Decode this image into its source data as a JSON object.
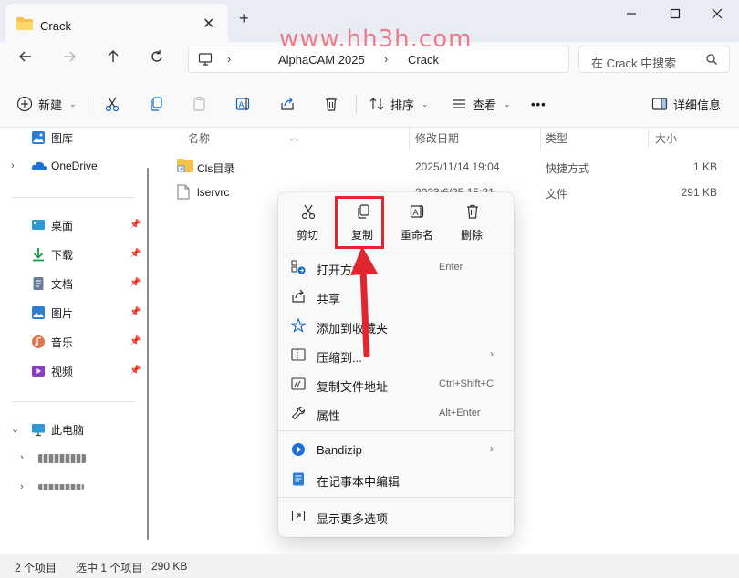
{
  "window": {
    "tab_title": "Crack",
    "new_tab": "+",
    "close_tab": "✕"
  },
  "watermark": "www.hh3h.com",
  "address": {
    "crumbs": [
      "AlphaCAM 2025",
      "Crack"
    ],
    "search_placeholder": "在 Crack 中搜索"
  },
  "toolbar": {
    "new_label": "新建",
    "sort_label": "排序",
    "view_label": "查看",
    "more_label": "•••",
    "details_label": "详细信息"
  },
  "sidebar": {
    "top_item": "图库",
    "onedrive": "OneDrive",
    "quick_access": [
      {
        "label": "桌面",
        "icon": "desktop-icon"
      },
      {
        "label": "下载",
        "icon": "download-icon"
      },
      {
        "label": "文档",
        "icon": "document-icon"
      },
      {
        "label": "图片",
        "icon": "pictures-icon"
      },
      {
        "label": "音乐",
        "icon": "music-icon"
      },
      {
        "label": "视频",
        "icon": "video-icon"
      }
    ],
    "this_pc": "此电脑"
  },
  "columns": {
    "name": "名称",
    "date": "修改日期",
    "type": "类型",
    "size": "大小"
  },
  "files": [
    {
      "name": "Cls目录",
      "date": "2025/11/14 19:04",
      "type": "快捷方式",
      "size": "1 KB"
    },
    {
      "name": "lservrc",
      "date": "2023/6/25 15:21",
      "type": "文件",
      "size": "291 KB"
    }
  ],
  "context_menu": {
    "quick_actions": [
      "剪切",
      "复制",
      "重命名",
      "删除"
    ],
    "items": [
      {
        "label": "打开方式",
        "key": "Enter",
        "icon": "open-with-icon"
      },
      {
        "label": "共享",
        "key": "",
        "icon": "share-icon"
      },
      {
        "label": "添加到收藏夹",
        "key": "",
        "icon": "star-icon"
      },
      {
        "label": "压缩到...",
        "key": "",
        "icon": "zip-folder-icon"
      },
      {
        "label": "复制文件地址",
        "key": "Ctrl+Shift+C",
        "icon": "copy-path-icon"
      },
      {
        "label": "属性",
        "key": "Alt+Enter",
        "icon": "wrench-icon"
      }
    ],
    "items2": [
      {
        "label": "Bandizip",
        "icon": "bandizip-icon"
      },
      {
        "label": "在记事本中编辑",
        "icon": "notepad-icon"
      }
    ],
    "more": "显示更多选项"
  },
  "status": {
    "count": "2 个项目",
    "selected": "选中 1 个项目",
    "size": "290 KB"
  },
  "colors": {
    "highlight": "#e0262e",
    "accent": "#0a64c8",
    "folder": "#f4c04e"
  }
}
